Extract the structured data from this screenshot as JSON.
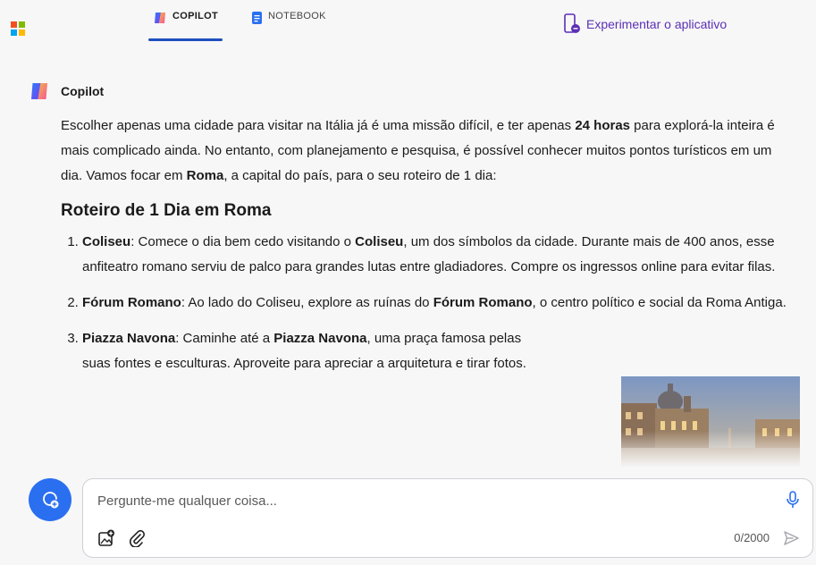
{
  "brand": {
    "colors": [
      "#f25022",
      "#7fba00",
      "#00a4ef",
      "#ffb900"
    ]
  },
  "tabs": [
    {
      "label": "COPILOT",
      "icon": "copilot-icon",
      "active": true
    },
    {
      "label": "NOTEBOOK",
      "icon": "notebook-icon",
      "active": false
    }
  ],
  "header": {
    "try_app": "Experimentar o aplicativo"
  },
  "message": {
    "sender": "Copilot",
    "intro": [
      {
        "t": "Escolher apenas uma cidade para visitar na Itália já é uma missão difícil, e ter apenas "
      },
      {
        "t": "24 horas",
        "b": true
      },
      {
        "t": " para explorá-la inteira é mais complicado ainda. No entanto, com planejamento e pesquisa, é possível conhecer muitos pontos turísticos em um dia. Vamos focar em "
      },
      {
        "t": "Roma",
        "b": true
      },
      {
        "t": ", a capital do país, para o seu roteiro de 1 dia:"
      }
    ],
    "heading": "Roteiro de 1 Dia em Roma",
    "items": [
      [
        {
          "t": "Coliseu",
          "b": true
        },
        {
          "t": ": Comece o dia bem cedo visitando o "
        },
        {
          "t": "Coliseu",
          "b": true
        },
        {
          "t": ", um dos símbolos da cidade. Durante mais de 400 anos, esse anfiteatro romano serviu de palco para grandes lutas entre gladiadores. Compre os ingressos online para evitar filas."
        }
      ],
      [
        {
          "t": "Fórum Romano",
          "b": true
        },
        {
          "t": ": Ao lado do Coliseu, explore as ruínas do "
        },
        {
          "t": "Fórum Romano",
          "b": true
        },
        {
          "t": ", o centro político e social da Roma Antiga."
        }
      ],
      [
        {
          "t": "Piazza Navona",
          "b": true
        },
        {
          "t": ": Caminhe até a "
        },
        {
          "t": "Piazza Navona",
          "b": true
        },
        {
          "t": ", uma praça famosa pelas suas fontes e esculturas. Aproveite para apreciar a arquitetura e tirar fotos."
        }
      ]
    ]
  },
  "composer": {
    "placeholder": "Pergunte-me qualquer coisa...",
    "counter": "0/2000"
  }
}
